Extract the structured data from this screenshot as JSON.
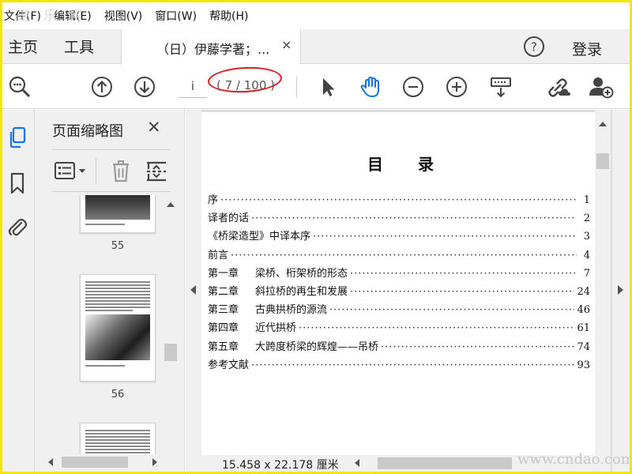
{
  "menu": [
    {
      "label": "文件(F)"
    },
    {
      "label": "编辑(E)"
    },
    {
      "label": "视图(V)"
    },
    {
      "label": "窗口(W)"
    },
    {
      "label": "帮助(H)"
    }
  ],
  "watermarks": {
    "top": "逆 乐 网",
    "bottom": "www.cndao.com"
  },
  "tabs": {
    "home": "主页",
    "tools": "工具",
    "document": "（日）伊藤学著；...",
    "close_symbol": "×"
  },
  "header": {
    "help_symbol": "?",
    "login": "登录"
  },
  "toolbar": {
    "page_value": "i",
    "page_count": "( 7 / 100 )",
    "icons": [
      "zoom-search-icon",
      "prev-page-icon",
      "next-page-icon",
      "select-cursor-icon",
      "hand-tool-icon",
      "zoom-out-icon",
      "zoom-in-icon",
      "page-display-icon",
      "link-icon",
      "add-user-icon"
    ],
    "highlight_color": "#d42020",
    "hand_color": "#1473e6"
  },
  "rail": {
    "icons": [
      "pages-icon",
      "bookmark-icon",
      "attachment-icon"
    ]
  },
  "thumbnail_panel": {
    "title": "页面缩略图",
    "close_symbol": "✕",
    "thumbnails": [
      {
        "label": "55"
      },
      {
        "label": "56"
      },
      {
        "label": ""
      }
    ]
  },
  "document": {
    "toc_title": "目录",
    "entries": [
      {
        "chapter": "",
        "title": "序",
        "page": "1"
      },
      {
        "chapter": "",
        "title": "译者的话",
        "page": "2"
      },
      {
        "chapter": "",
        "title": "《桥梁造型》中译本序",
        "page": "3"
      },
      {
        "chapter": "",
        "title": "前言",
        "page": "4"
      },
      {
        "chapter": "第一章",
        "title": "梁桥、桁架桥的形态",
        "page": "7"
      },
      {
        "chapter": "第二章",
        "title": "斜拉桥的再生和发展",
        "page": "24"
      },
      {
        "chapter": "第三章",
        "title": "古典拱桥的源流",
        "page": "46"
      },
      {
        "chapter": "第四章",
        "title": "近代拱桥",
        "page": "61"
      },
      {
        "chapter": "第五章",
        "title": "大跨度桥梁的辉煌——吊桥",
        "page": "74"
      },
      {
        "chapter": "",
        "title": "参考文献",
        "page": "93"
      }
    ]
  },
  "status": {
    "page_size": "15.458 x 22.178 厘米"
  }
}
